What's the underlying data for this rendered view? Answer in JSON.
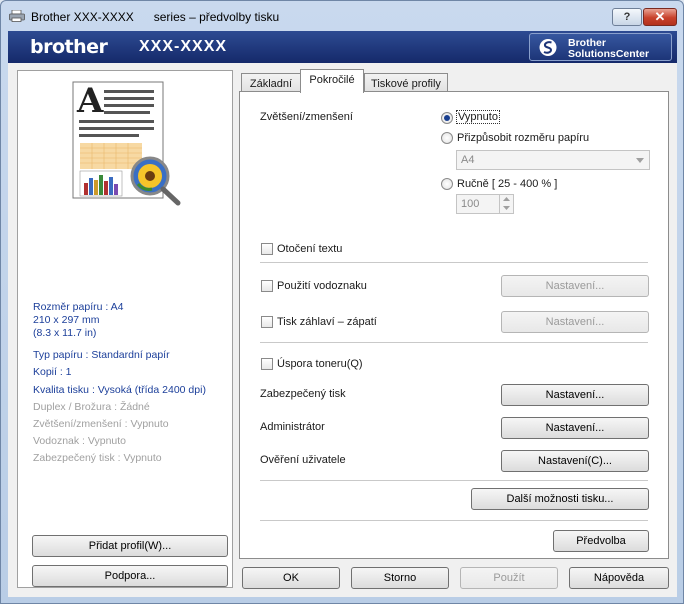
{
  "window": {
    "title_product": "Brother XXX-XXXX",
    "title_suffix": "series – předvolby tisku",
    "help_label": "?",
    "close_label": "✕"
  },
  "banner": {
    "logo_text": "brother",
    "model_text": "XXX-XXXX",
    "solutions_line1": "Brother",
    "solutions_line2": "SolutionsCenter"
  },
  "summary": {
    "paper_size": "Rozměr papíru : A4",
    "paper_dims": "210 x 297 mm",
    "paper_dims_in": "(8.3 x 11.7 in)",
    "media_type": "Typ papíru : Standardní papír",
    "copies": "Kopií : 1",
    "quality": "Kvalita tisku : Vysoká (třída 2400 dpi)",
    "duplex": "Duplex / Brožura : Žádné",
    "scaling": "Zvětšení/zmenšení : Vypnuto",
    "watermark": "Vodoznak : Vypnuto",
    "secure_print": "Zabezpečený tisk : Vypnuto"
  },
  "left_buttons": {
    "add_profile": "Přidat profil(W)...",
    "support": "Podpora..."
  },
  "tabs": [
    {
      "label": "Základní"
    },
    {
      "label": "Pokročilé"
    },
    {
      "label": "Tiskové profily"
    }
  ],
  "advanced": {
    "scaling_label": "Zvětšení/zmenšení",
    "scaling_options": [
      {
        "label": "Vypnuto",
        "selected": true
      },
      {
        "label": "Přizpůsobit rozměru papíru",
        "selected": false
      },
      {
        "label": "Ručně [ 25 - 400 % ]",
        "selected": false
      }
    ],
    "fit_paper_value": "A4",
    "manual_value": "100",
    "reverse_print": "Otočení textu",
    "use_watermark": "Použití vodoznaku",
    "header_footer": "Tisk záhlaví – zápatí",
    "toner_save": "Úspora toneru(Q)",
    "secure_print": "Zabezpečený tisk",
    "administrator": "Administrátor",
    "user_auth": "Ověření uživatele",
    "settings_label": "Nastavení...",
    "settings_c_label": "Nastavení(C)...",
    "other_options": "Další možnosti tisku...",
    "default": "Předvolba"
  },
  "bottom_buttons": {
    "ok": "OK",
    "cancel": "Storno",
    "apply": "Použít",
    "help": "Nápověda"
  },
  "colors": {
    "banner": "#1d3578",
    "summary_text": "#1c3f9a",
    "close_button": "#c8412b"
  }
}
